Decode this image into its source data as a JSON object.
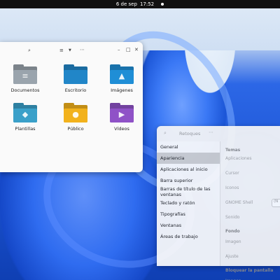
{
  "topbar": {
    "date": "6 de sep",
    "time": "17:52"
  },
  "files": {
    "items": [
      {
        "label": "Documentos",
        "icon": "documents-folder-icon",
        "color": "#9aa4ad",
        "glyph": "≡"
      },
      {
        "label": "Escritorio",
        "icon": "desktop-folder-icon",
        "color": "#2186c8",
        "glyph": ""
      },
      {
        "label": "Imágenes",
        "icon": "pictures-folder-icon",
        "color": "#1f8ed6",
        "glyph": "▲"
      },
      {
        "label": "Plantillas",
        "icon": "templates-folder-icon",
        "color": "#3aa0c9",
        "glyph": "◆"
      },
      {
        "label": "Público",
        "icon": "public-folder-icon",
        "color": "#f2b21c",
        "glyph": "●"
      },
      {
        "label": "Vídeos",
        "icon": "videos-folder-icon",
        "color": "#8f52c7",
        "glyph": "▶"
      }
    ]
  },
  "tweaks": {
    "title": "Retoques",
    "sidebar": [
      "General",
      "Apariencia",
      "Aplicaciones al inicio",
      "Barra superior",
      "Barras de título de las ventanas",
      "Teclado y ratón",
      "Tipografías",
      "Ventanas",
      "Áreas de trabajo"
    ],
    "selected_index": 1,
    "sections": {
      "temas": "Temas",
      "aplicaciones": "Aplicaciones",
      "cursor": "Cursor",
      "iconos": "Iconos",
      "gnome_shell": "GNOME Shell",
      "sonido": "Sonido",
      "fondo": "Fondo",
      "imagen": "Imagen",
      "ajuste": "Ajuste",
      "bloquear": "Bloquear la pantalla",
      "imagen2": "Imagen",
      "shell_combo": "(N"
    }
  }
}
